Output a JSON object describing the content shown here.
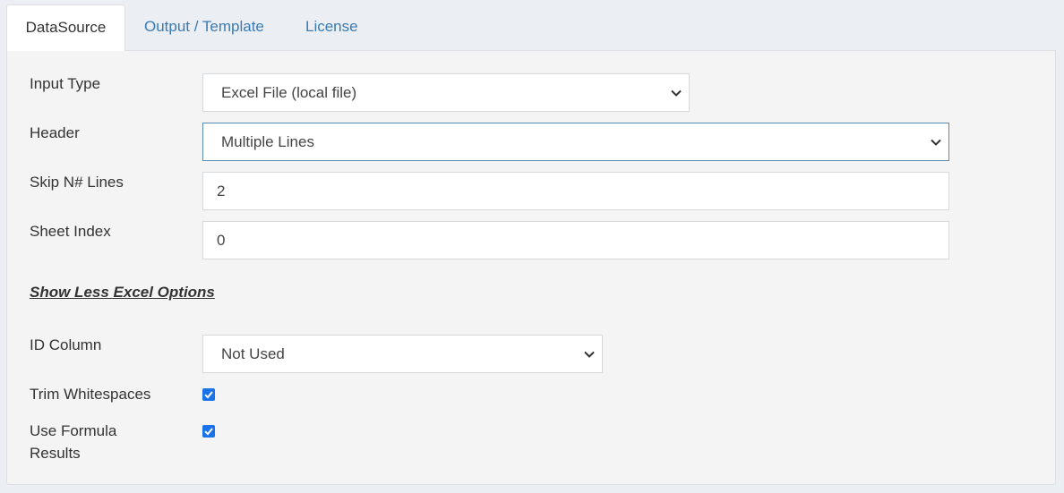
{
  "tabs": [
    {
      "label": "DataSource",
      "active": true
    },
    {
      "label": "Output / Template",
      "active": false
    },
    {
      "label": "License",
      "active": false
    }
  ],
  "form": {
    "input_type": {
      "label": "Input Type",
      "value": "Excel File (local file)"
    },
    "header": {
      "label": "Header",
      "value": "Multiple Lines"
    },
    "skip_lines": {
      "label": "Skip N# Lines",
      "value": "2"
    },
    "sheet_index": {
      "label": "Sheet Index",
      "value": "0"
    },
    "toggle_link": "Show Less Excel Options",
    "id_column": {
      "label": "ID Column",
      "value": "Not Used"
    },
    "trim_whitespaces": {
      "label": "Trim Whitespaces",
      "checked": true
    },
    "use_formula_results": {
      "label_line1": "Use Formula",
      "label_line2": "Results",
      "checked": true
    }
  },
  "colors": {
    "accent_link": "#3a7bb3",
    "checkbox": "#1a73e8",
    "focus_border": "#5b8bb4"
  }
}
